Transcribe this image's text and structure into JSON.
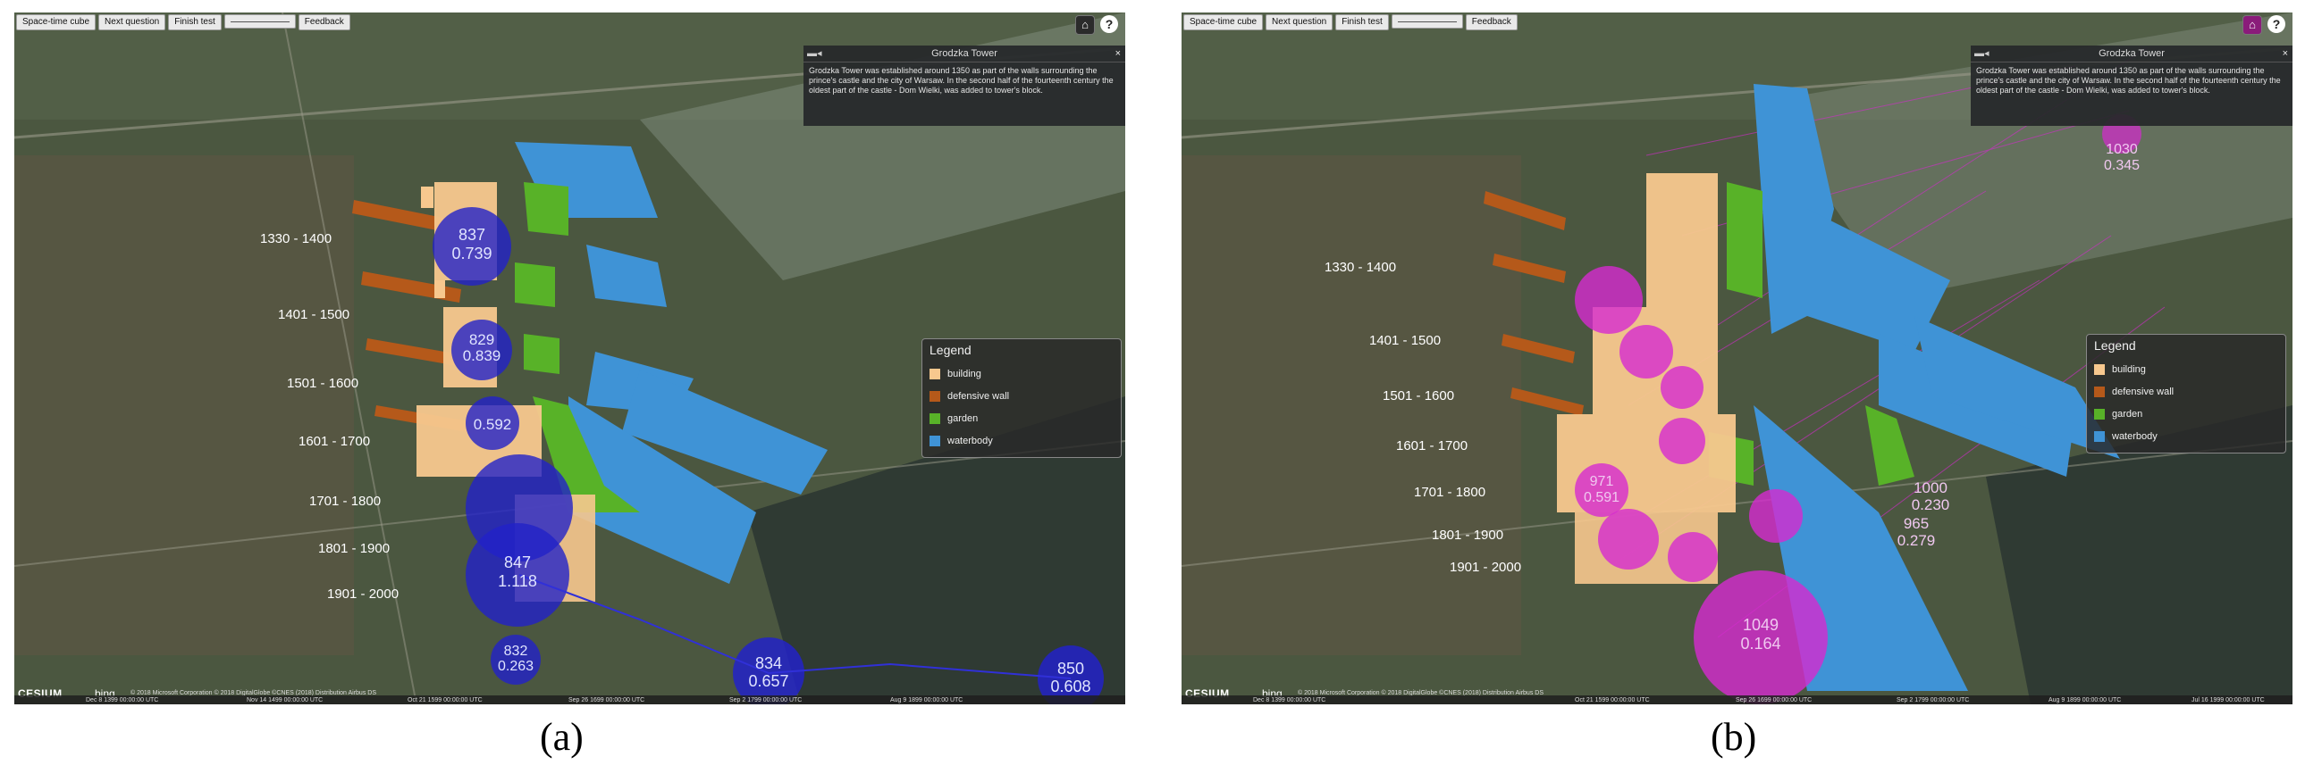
{
  "toolbar": {
    "space_time_cube": "Space-time cube",
    "next_question": "Next question",
    "finish_test": "Finish test",
    "feedback": "Feedback"
  },
  "info_panel": {
    "title": "Grodzka Tower",
    "text": "Grodzka Tower was established around 1350 as part of the walls surrounding the prince's castle and the city of Warsaw. In the second half of the fourteenth century the oldest part of the castle - Dom Wielki, was added to tower's block.",
    "close": "×"
  },
  "legend": {
    "title": "Legend",
    "items": [
      {
        "label": "building",
        "color": "#f7c88e"
      },
      {
        "label": "defensive wall",
        "color": "#b5591a"
      },
      {
        "label": "garden",
        "color": "#58b228"
      },
      {
        "label": "waterbody",
        "color": "#3f93d6"
      }
    ]
  },
  "footer": {
    "cesium": "CESIUM",
    "bing": "bing",
    "credit": "© 2018 Microsoft Corporation © 2018 DigitalGlobe ©CNES (2018) Distribution Airbus DS"
  },
  "panel_a": {
    "caption": "(a)",
    "period_labels": [
      "1330 - 1400",
      "1401 - 1500",
      "1501 - 1600",
      "1601 - 1700",
      "1701 - 1800",
      "1801 - 1900",
      "1901 - 2000"
    ],
    "timeline": [
      "Dec 8 1399 00:00:00 UTC",
      "Nov 14 1499 00:00:00 UTC",
      "Oct 21 1599 00:00:00 UTC",
      "Sep 26 1699 00:00:00 UTC",
      "Sep 2 1799 00:00:00 UTC",
      "Aug 9 1899 00:00:00 UTC"
    ],
    "bubbles": [
      {
        "n": "837",
        "v": "0.739"
      },
      {
        "n": "829",
        "v": "0.839"
      },
      {
        "n": "",
        "v": "0.592"
      },
      {
        "n": "847",
        "v": "1.118"
      },
      {
        "n": "832",
        "v": "0.263"
      },
      {
        "n": "834",
        "v": "0.657"
      },
      {
        "n": "850",
        "v": "0.608"
      }
    ],
    "bubble_color": "#2222c8"
  },
  "panel_b": {
    "caption": "(b)",
    "period_labels": [
      "1330 - 1400",
      "1401 - 1500",
      "1501 - 1600",
      "1601 - 1700",
      "1701 - 1800",
      "1801 - 1900",
      "1901 - 2000"
    ],
    "timeline": [
      "Dec 8 1399 00:00:00 UTC",
      "Oct 21 1599 00:00:00 UTC",
      "Sep 26 1699 00:00:00 UTC",
      "Sep 2 1799 00:00:00 UTC",
      "Aug 9 1899 00:00:00 UTC",
      "Jul 16 1999 00:00:00 UTC"
    ],
    "bubbles": [
      {
        "n": "1000",
        "v": "0.230"
      },
      {
        "n": "965",
        "v": "0.279"
      },
      {
        "n": "1049",
        "v": "0.164"
      },
      {
        "n": "1030",
        "v": "0.345"
      },
      {
        "n": "971",
        "v": "0.591"
      }
    ],
    "bubble_color": "#d62ad0"
  }
}
